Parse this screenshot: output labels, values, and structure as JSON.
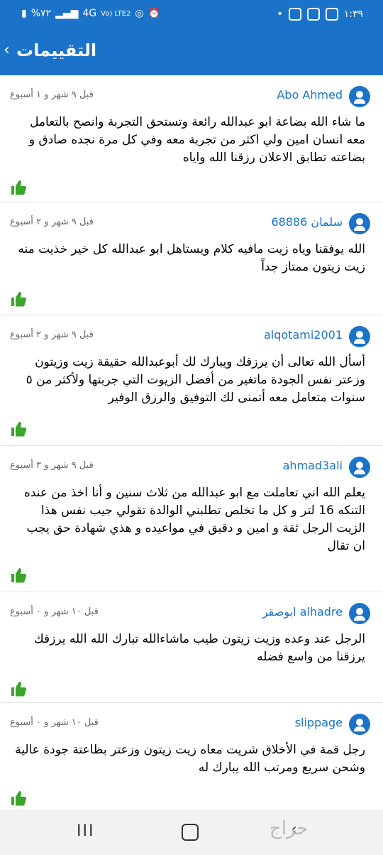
{
  "status_bar": {
    "battery": "%٧٢",
    "network": "4G",
    "volte": "Vo) LTE2",
    "time": "١:٣٩"
  },
  "app_bar": {
    "title": "التقييمات",
    "back_glyph": "‹"
  },
  "reviews": [
    {
      "name": "Abo Ahmed",
      "time": "قبل ٩ شهر و ١ أسبوع",
      "text": "ما شاء الله بضاعة ابو عبدالله رائعة وتستحق التجربة وانصح بالتعامل معه انسان امين ولي اكثر من تجربة معه وفي كل مرة نجده صادق و بضاعته تطابق الاعلان رزقنا الله واياه"
    },
    {
      "name": "سلمان 68886",
      "time": "قبل ٩ شهر و ٢ أسبوع",
      "text": "الله يوفقنا وياه زيت مافيه كلام ويستاهل ابو عبدالله كل خير خذيت منه زيت زيتون ممتاز جداً"
    },
    {
      "name": "alqotami2001",
      "time": "قبل ٩ شهر و ٢ أسبوع",
      "text": "أسأل الله تعالى أن يرزقك ويبارك لك أبوعبدالله حقيقة زيت وزيتون وزعتر نفس الجودة ماتغير من أفضل الزيوت التي جربتها ولأكثر من ٥ سنوات متعامل معه أتمنى لك التوفيق والرزق الوفير"
    },
    {
      "name": "ahmad3ali",
      "time": "قبل ٩ شهر و ٣ أسبوع",
      "text": "يعلم الله اني تعاملت مع ابو عبدالله من ثلاث سنين و أنا اخذ من عنده التنكه 16 لتر و كل ما تخلص تطلبني الوالدة تقولي جيب نفس هذا الزيت الرجل ثقة و امين و دقيق في مواعيده و هذي شهادة حق يجب ان تقال"
    },
    {
      "name": "ابوصقر alhadre",
      "time": "قبل ١٠ شهر و ٠ أسبوع",
      "text": "الرجل عند وعده وزيت زيتون طيب ماشاءالله تبارك الله الله يرزقك يرزقنا من واسع فضله"
    },
    {
      "name": "slippage",
      "time": "قبل ١٠ شهر و ٠ أسبوع",
      "text": "رجل قمة في الأخلاق شريت معاه زيت زيتون وزعتر بظاعتة جودة عالية وشحن سريع ومرتب الله يبارك له"
    }
  ],
  "nav_bar": {
    "recent_glyph": "III",
    "back_glyph": "‹"
  },
  "watermark": "حراج",
  "colors": {
    "accent": "#1a73c8",
    "like": "#3aa52b"
  }
}
